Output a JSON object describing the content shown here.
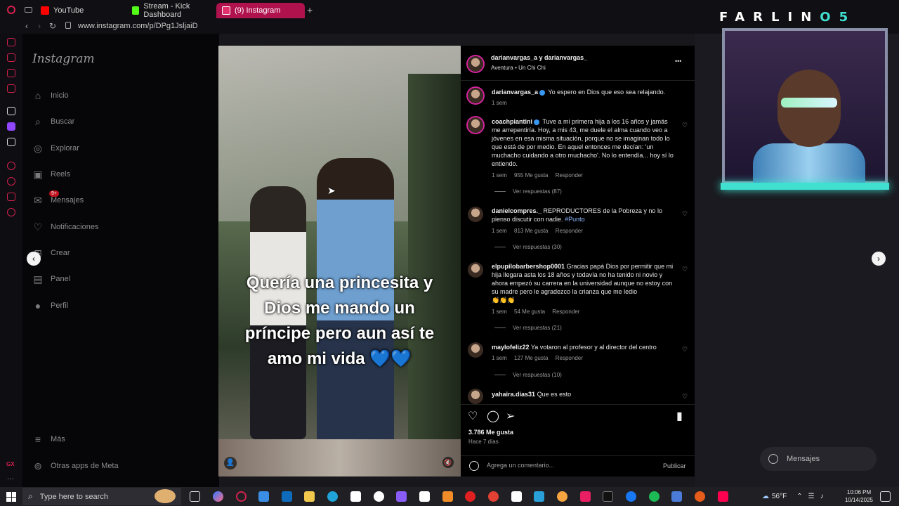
{
  "browser": {
    "tabs": [
      {
        "label": "YouTube",
        "icon": "youtube-icon",
        "color": "#ff0000"
      },
      {
        "label": "Stream - Kick Dashboard",
        "icon": "kick-icon",
        "color": "#53fc18"
      },
      {
        "label": "(9) Instagram",
        "icon": "instagram-icon",
        "color": "#e1306c"
      }
    ],
    "new_tab": "+",
    "url": "www.instagram.com/p/DPg1JsljaiD"
  },
  "instagram_nav": {
    "logo": "Instagram",
    "items": [
      {
        "label": "Inicio",
        "icon": "home-icon"
      },
      {
        "label": "Buscar",
        "icon": "search-icon"
      },
      {
        "label": "Explorar",
        "icon": "compass-icon"
      },
      {
        "label": "Reels",
        "icon": "reels-icon"
      },
      {
        "label": "Mensajes",
        "icon": "messenger-icon",
        "badge": "9+"
      },
      {
        "label": "Notificaciones",
        "icon": "heart-icon"
      },
      {
        "label": "Crear",
        "icon": "plus-icon"
      },
      {
        "label": "Panel",
        "icon": "chart-icon"
      },
      {
        "label": "Perfil",
        "icon": "avatar-icon"
      }
    ],
    "more": "Más",
    "meta_apps": "Otras apps de Meta"
  },
  "video": {
    "caption_lines": [
      "Quería una princesita y",
      "Dios me mando un",
      "príncipe pero aun así te",
      "amo mi vida"
    ],
    "caption_hearts": "💙💙"
  },
  "post": {
    "header": {
      "users": "darianvargas_a y darianvargas_",
      "audio": "Aventura",
      "song": "Un Chi Chi",
      "more": "•••"
    },
    "caption": {
      "user": "darianvargas_a",
      "text": "Yo espero en Dios que eso sea relajando.",
      "time": "1 sem"
    },
    "comments": [
      {
        "user": "coachpiantini",
        "verified": true,
        "text": "Tuve a mi primera hija a los 16 años y jamás me arrepentiría. Hoy, a mis 43, me duele el alma cuando veo a jóvenes en esa misma situación, porque no se imaginan todo lo que está de por medio. En aquel entonces me decían: 'un muchacho cuidando a otro muchacho'. No lo entendía... hoy sí lo entiendo.",
        "time": "1 sem",
        "likes": "955 Me gusta",
        "reply": "Responder",
        "replies": "Ver respuestas (87)"
      },
      {
        "user": "danielcompres._",
        "text": "REPRODUCTORES de la Pobreza y no lo pienso discutir con nadie.",
        "hashtag": "#Punto",
        "time": "1 sem",
        "likes": "813 Me gusta",
        "reply": "Responder",
        "replies": "Ver respuestas (30)"
      },
      {
        "user": "elpupilobarbershop0001",
        "text": "Gracias papá Dios por permitir que mi hija llegara asta los 18 años y todavía no ha tenido ni novio y ahora empezó su carrera en la universidad aunque no estoy con su madre pero le agradezco la crianza que me ledio",
        "emoji": "👏👏👏",
        "time": "1 sem",
        "likes": "54 Me gusta",
        "reply": "Responder",
        "replies": "Ver respuestas (21)"
      },
      {
        "user": "maylofeliz22",
        "text": "Ya votaron al profesor y al director del centro",
        "time": "1 sem",
        "likes": "127 Me gusta",
        "reply": "Responder",
        "replies": "Ver respuestas (10)"
      },
      {
        "user": "yahaira.dias31",
        "text": "Que es esto"
      }
    ],
    "likes": "3.786 Me gusta",
    "date": "Hace 7 días",
    "comment_placeholder": "Agrega un comentario...",
    "publish": "Publicar"
  },
  "overlay": {
    "stream_title_letters": "FARLIN",
    "stream_title_suffix": "O5",
    "messages_pill": "Mensajes"
  },
  "taskbar": {
    "search_placeholder": "Type here to search",
    "weather": "56°F",
    "time": "10:06 PM",
    "date": "10/14/2025"
  },
  "colors": {
    "accent": "#b0124e",
    "instagram_bg": "#000000",
    "glow": "#40e0d0"
  }
}
